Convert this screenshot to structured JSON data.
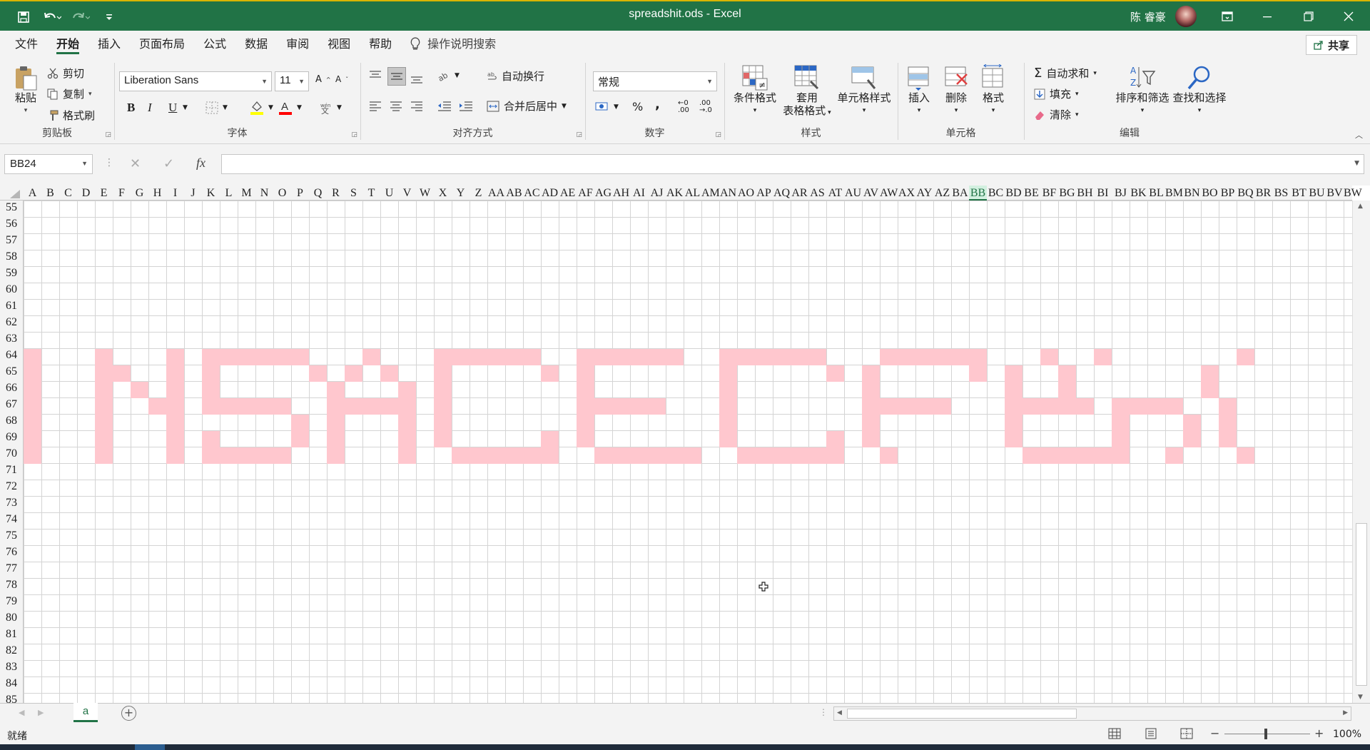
{
  "title_bar": {
    "document_title": "spreadshit.ods  -  Excel",
    "user_name": "陈 睿豪",
    "qa_icons": [
      "save-icon",
      "undo-icon",
      "redo-icon",
      "customize-icon"
    ]
  },
  "menu": {
    "tabs": [
      "文件",
      "开始",
      "插入",
      "页面布局",
      "公式",
      "数据",
      "审阅",
      "视图",
      "帮助"
    ],
    "active_tab": "开始",
    "tell_me": "操作说明搜索",
    "share_label": "共享"
  },
  "ribbon": {
    "clipboard": {
      "label": "剪贴板",
      "paste": "粘贴",
      "cut": "剪切",
      "copy": "复制",
      "format_painter": "格式刷"
    },
    "font": {
      "label": "字体",
      "font_name": "Liberation Sans",
      "font_size": "11",
      "bold": "B",
      "italic": "I",
      "underline": "U"
    },
    "alignment": {
      "label": "对齐方式",
      "wrap": "自动换行",
      "merge": "合并后居中"
    },
    "number": {
      "label": "数字",
      "format": "常规",
      "percent": "%",
      "comma": ","
    },
    "styles": {
      "label": "样式",
      "conditional": "条件格式",
      "table_l1": "套用",
      "table_l2": "表格格式",
      "cell_styles": "单元格样式"
    },
    "cells": {
      "label": "单元格",
      "insert": "插入",
      "delete": "删除",
      "format": "格式"
    },
    "editing": {
      "label": "编辑",
      "autosum": "自动求和",
      "fill": "填充",
      "clear": "清除",
      "sort": "排序和筛选",
      "find": "查找和选择"
    }
  },
  "formula_bar": {
    "name_box": "BB24",
    "fx": "fx",
    "cancel": "✕",
    "enter": "✓",
    "formula": ""
  },
  "sheet": {
    "columns": [
      "A",
      "B",
      "C",
      "D",
      "E",
      "F",
      "G",
      "H",
      "I",
      "J",
      "K",
      "L",
      "M",
      "N",
      "O",
      "P",
      "Q",
      "R",
      "S",
      "T",
      "U",
      "V",
      "W",
      "X",
      "Y",
      "Z",
      "AA",
      "AB",
      "AC",
      "AD",
      "AE",
      "AF",
      "AG",
      "AH",
      "AI",
      "AJ",
      "AK",
      "AL",
      "AM",
      "AN",
      "AO",
      "AP",
      "AQ",
      "AR",
      "AS",
      "AT",
      "AU",
      "AV",
      "AW",
      "AX",
      "AY",
      "AZ",
      "BA",
      "BB",
      "BC",
      "BD",
      "BE",
      "BF",
      "BG",
      "BH",
      "BI",
      "BJ",
      "BK",
      "BL",
      "BM",
      "BN",
      "BO",
      "BP",
      "BQ",
      "BR",
      "BS",
      "BT",
      "BU",
      "BV",
      "BW"
    ],
    "selected_column": "BB",
    "rows": [
      55,
      56,
      57,
      58,
      59,
      60,
      61,
      62,
      63,
      64,
      65,
      66,
      67,
      68,
      69,
      70,
      71,
      72,
      73,
      74,
      75,
      76,
      77,
      78,
      79,
      80,
      81,
      82,
      83,
      84,
      85
    ],
    "pixel_art_rows": [
      "#...#...#.######...#...######..######..######...######...#..#.......#",
      "#...##..#.#.....#.#.#..#.....#.#.......#.....#.#.....#.#..#.......#",
      "#...#.#.#.#......#...#.#.......#.......#.......#.......#..#.......#",
      "#...#..##.#####..#####.#.......#####...#.......#####...#####.####..#",
      "#...#...#......#.#...#.#.......#.......#.......#.......#.....#...#.#",
      "#...#...#.#....#.#...#.#.....#.#.......#.....#.#.......#.....#...#.#",
      "#...#...#.#####..#...#..######..######..######..#.......######..#...#"
    ],
    "pixel_color": "#ffc7ce",
    "sheet_tab": "a"
  },
  "status": {
    "ready": "就绪",
    "zoom": "100%"
  },
  "colors": {
    "accent": "#217346",
    "ribbon_bg": "#f3f3f3",
    "gridline": "#d4d4d4"
  }
}
